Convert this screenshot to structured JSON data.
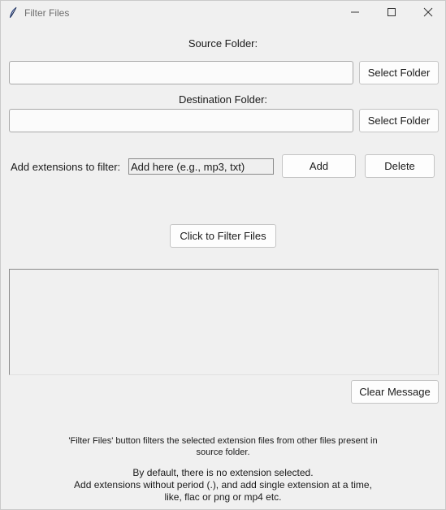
{
  "window": {
    "title": "Filter Files",
    "icons": {
      "app": "feather-icon",
      "minimize": "minimize-icon",
      "maximize": "maximize-icon",
      "close": "close-icon"
    }
  },
  "source": {
    "label": "Source Folder:",
    "value": "",
    "button": "Select Folder"
  },
  "destination": {
    "label": "Destination Folder:",
    "value": "",
    "button": "Select Folder"
  },
  "extensions": {
    "label": "Add extensions to filter:",
    "value": "Add here (e.g., mp3, txt)",
    "add_button": "Add",
    "delete_button": "Delete"
  },
  "filter_button": "Click to Filter Files",
  "message_box": {
    "content": ""
  },
  "clear_button": "Clear Message",
  "info": {
    "line1": "'Filter Files' button filters the selected extension files from other files present in",
    "line2": "source folder.",
    "line3": "By default, there is no extension selected.",
    "line4": "Add extensions without period (.), and add single extension at a time,",
    "line5": "like, flac or png or mp4 etc."
  }
}
